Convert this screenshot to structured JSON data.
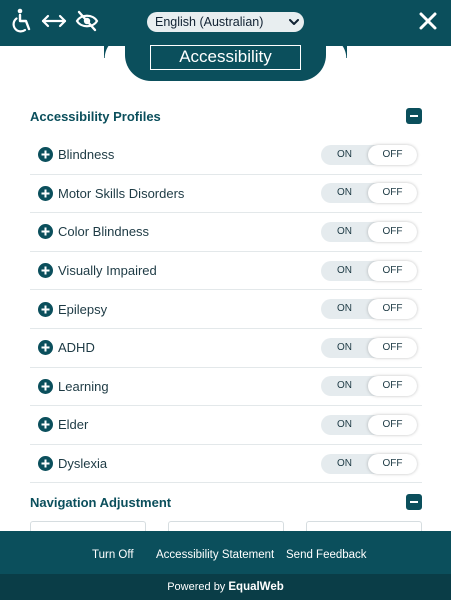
{
  "header": {
    "language_selected": "English (Australian)",
    "icons": [
      "accessibility-person-icon",
      "swap-arrows-icon",
      "eye-off-icon",
      "chevron-down-icon",
      "close-icon"
    ],
    "title": "Accessibility"
  },
  "profiles_section": {
    "title": "Accessibility Profiles",
    "items": [
      {
        "label": "Blindness",
        "on": "ON",
        "off": "OFF"
      },
      {
        "label": "Motor Skills Disorders",
        "on": "ON",
        "off": "OFF"
      },
      {
        "label": "Color Blindness",
        "on": "ON",
        "off": "OFF"
      },
      {
        "label": "Visually Impaired",
        "on": "ON",
        "off": "OFF"
      },
      {
        "label": "Epilepsy",
        "on": "ON",
        "off": "OFF"
      },
      {
        "label": "ADHD",
        "on": "ON",
        "off": "OFF"
      },
      {
        "label": "Learning",
        "on": "ON",
        "off": "OFF"
      },
      {
        "label": "Elder",
        "on": "ON",
        "off": "OFF"
      },
      {
        "label": "Dyslexia",
        "on": "ON",
        "off": "OFF"
      }
    ],
    "selected_state": "OFF"
  },
  "navigation_section": {
    "title": "Navigation Adjustment"
  },
  "footer": {
    "turn_off": "Turn Off",
    "statement": "Accessibility Statement",
    "feedback": "Send Feedback",
    "powered_prefix": "Powered by",
    "powered_brand": "EqualWeb"
  },
  "colors": {
    "primary": "#0b4f5c",
    "footer_bottom": "#0a3d47",
    "toggle_track": "#e5ebee"
  }
}
